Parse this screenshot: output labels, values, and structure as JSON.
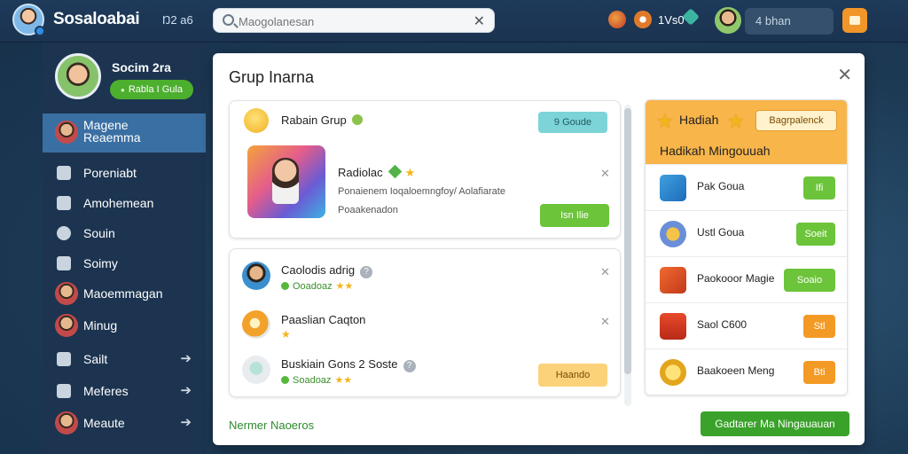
{
  "topbar": {
    "brand": "Sosaloabai",
    "brand_sub": "Ŋ2 a6",
    "search_placeholder": "Maogolanesan",
    "coins": "1Vs0",
    "user_label": "4 bhan"
  },
  "sidebar": {
    "profile_name": "Socim 2ra",
    "profile_button": "Rabla I Gula",
    "items": [
      {
        "label": "Magene\nReaemma",
        "icon": "avatar"
      },
      {
        "label": "Poreniabt",
        "icon": "gamepad-icon"
      },
      {
        "label": "Amohemean",
        "icon": "puzzle-icon"
      },
      {
        "label": "Souin",
        "icon": "circle-icon"
      },
      {
        "label": "Soimy",
        "icon": "tools-icon"
      },
      {
        "label": "Maoemmagan",
        "icon": "avatar"
      },
      {
        "label": "Minug",
        "icon": "avatar"
      },
      {
        "label": "Sailt",
        "icon": "chat-icon",
        "chevron": true
      },
      {
        "label": "Meferes",
        "icon": "video-icon",
        "chevron": true
      },
      {
        "label": "Meaute",
        "icon": "avatar",
        "chevron": true
      }
    ]
  },
  "panel": {
    "title": "Grup Inarna",
    "group": {
      "title": "Rabain Grup",
      "join_button": "9 Goude",
      "game_name": "Radiolac",
      "game_desc": "Ponaienem Ioqaloemngfoy/ Aolafiarate Poaakenadon",
      "play_button": "Isn Ilie"
    },
    "friends": [
      {
        "name": "Caolodis adrig",
        "status": "Ooadoaz"
      },
      {
        "name": "Paaslian Caqton",
        "status": ""
      },
      {
        "name": "Buskiain Gons 2 Soste",
        "status": "Soadoaz"
      }
    ],
    "friend_button": "Haando",
    "footer_link": "Nermer Naoeros",
    "footer_button": "Gadtarer Ma Ningauauan"
  },
  "rewards": {
    "title": "Hadiah",
    "pill": "Bagrpalenck",
    "subtitle": "Hadikah Mingouuah",
    "items": [
      {
        "label": "Pak Goua",
        "button": "Ifi",
        "color": "green"
      },
      {
        "label": "Ustl Goua",
        "button": "Soeit",
        "color": "green"
      },
      {
        "label": "Paokooor Magie",
        "button": "Soaio",
        "color": "green"
      },
      {
        "label": "Saol C600",
        "button": "Stl",
        "color": "orange"
      },
      {
        "label": "Baakoeen Meng",
        "button": "Bti",
        "color": "orange"
      }
    ]
  }
}
